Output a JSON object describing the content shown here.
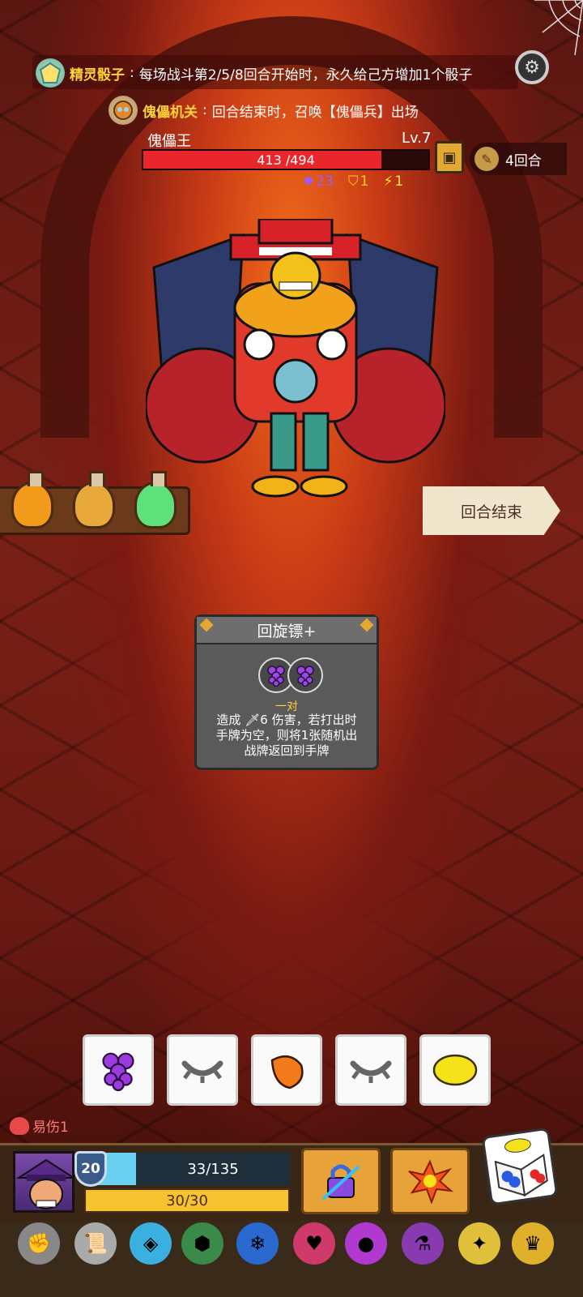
{
  "passives": [
    {
      "name": "精灵骰子",
      "colon": ":",
      "text": "每场战斗第2/5/8回合开始时，永久给己方增加1个骰子"
    },
    {
      "name": "傀儡机关",
      "colon": ":",
      "text": "回合结束时，召唤【傀儡兵】出场"
    }
  ],
  "boss": {
    "name": "傀儡王",
    "level": "Lv.7",
    "hp_current": 413,
    "hp_max": 494,
    "hp_text": "413 /494",
    "stats": [
      {
        "icon": "claw-icon",
        "value": "23",
        "color": "#9a5cff"
      },
      {
        "icon": "shield-icon",
        "value": "1",
        "color": "#ffcc1a"
      },
      {
        "icon": "lightning-icon",
        "value": "1",
        "color": "#ffe23a"
      }
    ]
  },
  "turn": {
    "label": "4回合"
  },
  "end_turn": {
    "label": "回合结束"
  },
  "card": {
    "title": "回旋镖+",
    "pair_label": "一对",
    "desc_line1": "造成 ",
    "damage": "6",
    "desc_line1b": " 伤害，若打出时",
    "desc_line2": "手牌为空，则将1张随机出",
    "desc_line3": "战牌返回到手牌"
  },
  "hand": [
    {
      "icon": "grapes-icon"
    },
    {
      "icon": "closed-eye-icon"
    },
    {
      "icon": "orange-icon"
    },
    {
      "icon": "closed-eye-icon"
    },
    {
      "icon": "lemon-icon"
    }
  ],
  "status": {
    "label": "易伤1"
  },
  "player": {
    "armor": "20",
    "hp_current": 33,
    "hp_max": 135,
    "hp_text": "33/135",
    "energy_text": "30/30"
  },
  "colors": {
    "hp_red": "#e8262c",
    "player_hp": "#6ad0f0",
    "energy": "#f6c230",
    "accent_gold": "#ffd23a"
  }
}
